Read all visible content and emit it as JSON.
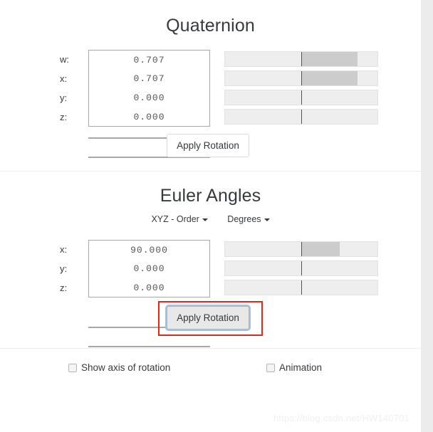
{
  "quaternion": {
    "title": "Quaternion",
    "rows": [
      {
        "label": "w:",
        "value": "0.707",
        "fill_from_center_pct": 70.7
      },
      {
        "label": "x:",
        "value": "0.707",
        "fill_from_center_pct": 70.7
      },
      {
        "label": "y:",
        "value": "0.000",
        "fill_from_center_pct": 0
      },
      {
        "label": "z:",
        "value": "0.000",
        "fill_from_center_pct": 0
      }
    ],
    "apply_button": "Apply Rotation"
  },
  "euler": {
    "title": "Euler Angles",
    "order_dropdown": "XYZ - Order",
    "units_dropdown": "Degrees",
    "rows": [
      {
        "label": "x:",
        "value": "90.000",
        "fill_from_center_pct": 50
      },
      {
        "label": "y:",
        "value": "0.000",
        "fill_from_center_pct": 0
      },
      {
        "label": "z:",
        "value": "0.000",
        "fill_from_center_pct": 0
      }
    ],
    "apply_button": "Apply Rotation"
  },
  "options": {
    "show_axis_label": "Show axis of rotation",
    "show_axis_checked": false,
    "animation_label": "Animation",
    "animation_checked": false
  },
  "watermark": "https://blog.csdn.net/HW140701",
  "colors": {
    "text": "#373a3c",
    "slider_track": "#eeeeee",
    "slider_fill": "#cccccc",
    "annotation": "#e8241c",
    "focus_ring": "#9ec5e8"
  }
}
